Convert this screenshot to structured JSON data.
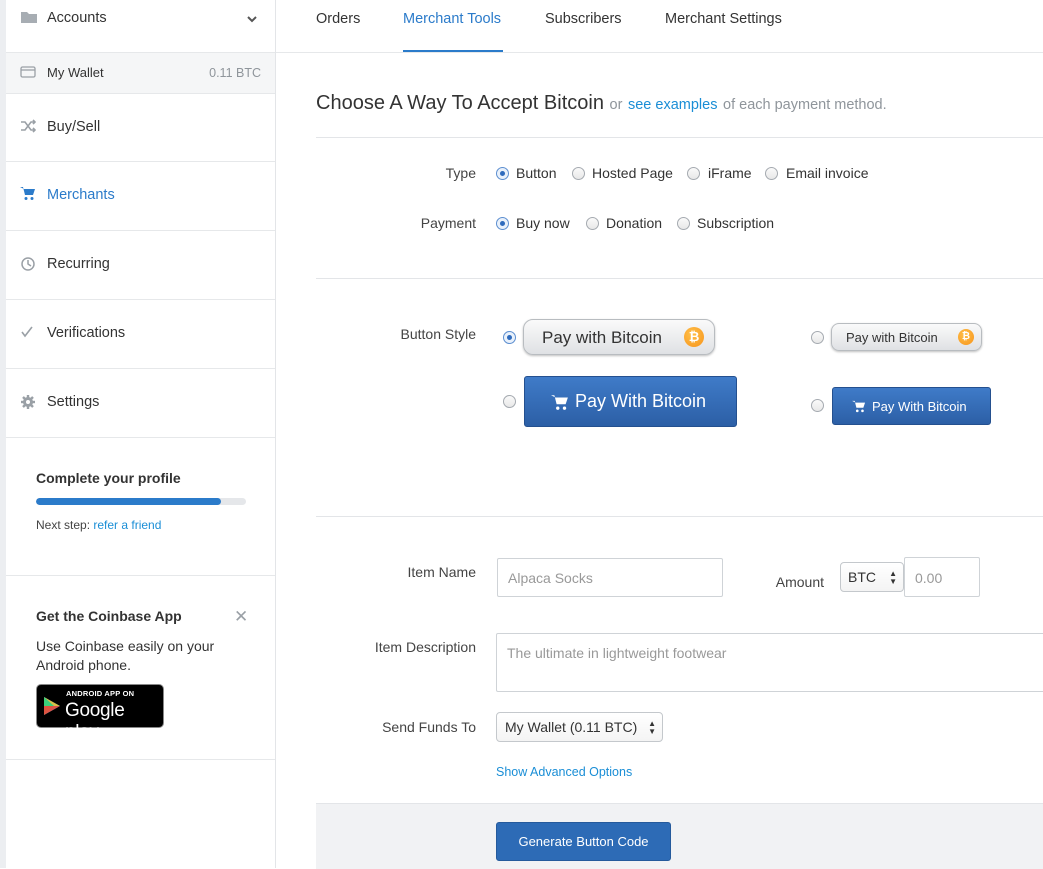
{
  "sidebar": {
    "accounts_label": "Accounts",
    "wallet": {
      "name": "My Wallet",
      "balance": "0.11 BTC"
    },
    "items": [
      {
        "label": "Buy/Sell",
        "icon": "shuffle-icon"
      },
      {
        "label": "Merchants",
        "icon": "cart-icon",
        "active": true
      },
      {
        "label": "Recurring",
        "icon": "history-icon"
      },
      {
        "label": "Verifications",
        "icon": "check-icon"
      },
      {
        "label": "Settings",
        "icon": "gear-icon"
      }
    ],
    "profile": {
      "title": "Complete your profile",
      "progress_fraction": 0.88,
      "next_step_prefix": "Next step:",
      "next_step_link": "refer a friend"
    },
    "app_promo": {
      "title": "Get the Coinbase App",
      "text": "Use Coinbase easily on your Android phone.",
      "badge_top": "ANDROID APP ON",
      "badge_bottom": "Google play"
    }
  },
  "tabs": [
    {
      "label": "Orders"
    },
    {
      "label": "Merchant Tools",
      "active": true
    },
    {
      "label": "Subscribers"
    },
    {
      "label": "Merchant Settings"
    }
  ],
  "heading": {
    "title": "Choose A Way To Accept Bitcoin",
    "or": "or",
    "link": "see examples",
    "suffix": "of each payment method."
  },
  "type_row": {
    "label": "Type",
    "options": [
      "Button",
      "Hosted Page",
      "iFrame",
      "Email invoice"
    ],
    "selected": "Button"
  },
  "payment_row": {
    "label": "Payment",
    "options": [
      "Buy now",
      "Donation",
      "Subscription"
    ],
    "selected": "Buy now"
  },
  "button_style": {
    "label": "Button Style",
    "options": [
      {
        "text": "Pay with Bitcoin",
        "style": "silver-large",
        "selected": true
      },
      {
        "text": "Pay with Bitcoin",
        "style": "silver-small"
      },
      {
        "text": "Pay With Bitcoin",
        "style": "blue-large"
      },
      {
        "text": "Pay With Bitcoin",
        "style": "blue-small"
      }
    ],
    "coin_symbol": "₿"
  },
  "form": {
    "item_name_label": "Item Name",
    "item_name_placeholder": "Alpaca Socks",
    "amount_label": "Amount",
    "currency": "BTC",
    "amount_placeholder": "0.00",
    "item_desc_label": "Item Description",
    "item_desc_placeholder": "The ultimate in lightweight footwear",
    "send_funds_label": "Send Funds To",
    "send_funds_value": "My Wallet (0.11 BTC)",
    "advanced_link": "Show Advanced Options",
    "generate_label": "Generate Button Code"
  },
  "colors": {
    "accent": "#2b7bca",
    "button_blue": "#2d6bb6",
    "bitcoin_orange": "#f7931a"
  }
}
